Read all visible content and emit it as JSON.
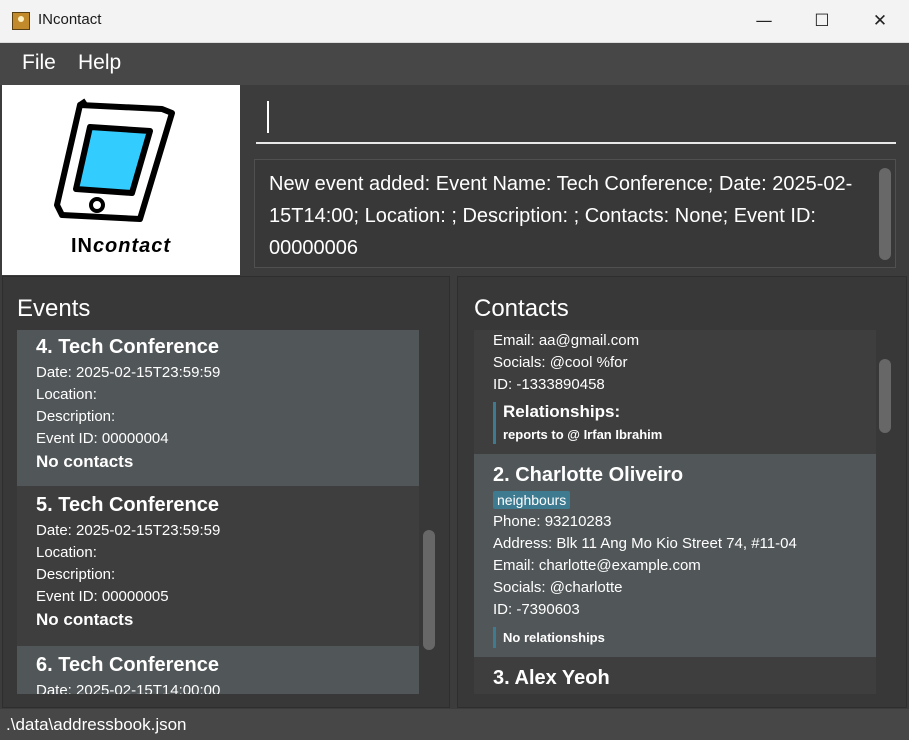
{
  "window": {
    "title": "INcontact",
    "minimize": "—",
    "maximize": "☐",
    "close": "✕"
  },
  "menu": [
    {
      "label": "File"
    },
    {
      "label": "Help"
    }
  ],
  "logo": {
    "text_prefix": "IN",
    "text_suffix": "contact"
  },
  "command": {
    "value": "",
    "placeholder": ""
  },
  "result": {
    "text": "New event added: Event Name: Tech Conference; Date: 2025-02-15T14:00; Location: ; Description: ; Contacts: None; Event ID: 00000006"
  },
  "events": {
    "title": "Events",
    "items": [
      {
        "title": "4.  Tech Conference",
        "date": "Date: 2025-02-15T23:59:59",
        "location": "Location:",
        "description": "Description:",
        "id": "Event ID: 00000004",
        "contacts": "No contacts"
      },
      {
        "title": "5.  Tech Conference",
        "date": "Date: 2025-02-15T23:59:59",
        "location": "Location:",
        "description": "Description:",
        "id": "Event ID: 00000005",
        "contacts": "No contacts"
      },
      {
        "title": "6.  Tech Conference",
        "date": "Date: 2025-02-15T14:00:00"
      }
    ]
  },
  "contacts": {
    "title": "Contacts",
    "partial": {
      "email": "Email: aa@gmail.com",
      "socials": "Socials: @cool %for",
      "id": "ID: -1333890458",
      "rel_heading": "Relationships:",
      "rel_item": "reports to @  Irfan Ibrahim"
    },
    "items": [
      {
        "title": "2. Charlotte Oliveiro",
        "tag": "neighbours",
        "phone": "Phone: 93210283",
        "address": "Address: Blk 11 Ang Mo Kio Street 74, #11-04",
        "email": "Email: charlotte@example.com",
        "socials": "Socials: @charlotte",
        "id": "ID: -7390603",
        "rel": "No relationships"
      },
      {
        "title": "3. Alex Yeoh"
      }
    ]
  },
  "status": {
    "path": ".\\data\\addressbook.json"
  }
}
